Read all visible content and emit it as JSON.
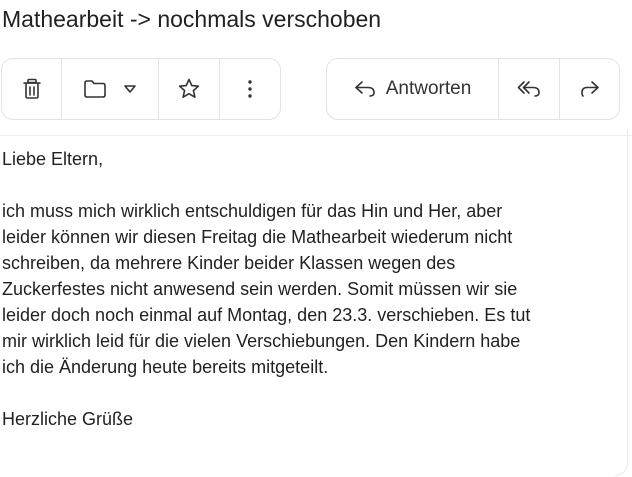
{
  "email": {
    "subject": "Mathearbeit -> nochmals verschoben",
    "body": {
      "greeting": "Liebe Eltern,",
      "paragraph_lines": [
        "ich muss mich wirklich entschuldigen für das Hin und Her, aber",
        "leider können wir diesen Freitag die Mathearbeit wiederum nicht",
        "schreiben, da mehrere Kinder beider Klassen wegen des",
        "Zuckerfestes nicht anwesend sein werden. Somit müssen wir sie",
        "leider doch noch einmal auf Montag, den 23.3. verschieben. Es tut",
        "mir wirklich leid für die vielen Verschiebungen. Den Kindern habe",
        "ich die Änderung heute bereits mitgeteilt."
      ],
      "closing": "Herzliche Grüße"
    }
  },
  "toolbar": {
    "left_icons": [
      "trash-icon",
      "folder-icon",
      "chevron-down-icon",
      "star-icon",
      "more-vertical-icon"
    ],
    "reply_label": "Antworten",
    "right_icons": [
      "reply-icon",
      "reply-all-icon",
      "forward-icon"
    ]
  }
}
